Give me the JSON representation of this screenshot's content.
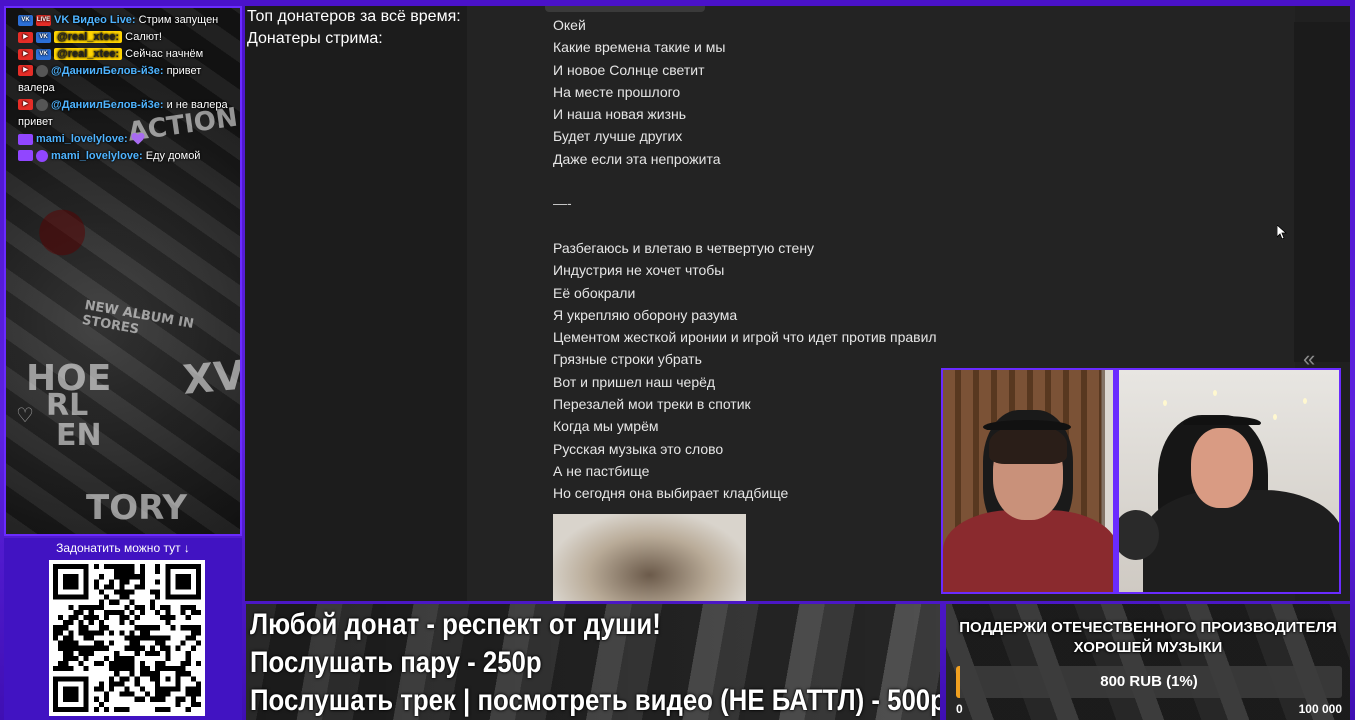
{
  "chat": {
    "messages": [
      {
        "badges": [
          "vk",
          "live"
        ],
        "nick": "VK Видео Live:",
        "nick_style": "plain",
        "text": "Стрим запущен"
      },
      {
        "badges": [
          "yt",
          "vk"
        ],
        "nick": "@real_xtee:",
        "nick_style": "highlight",
        "text": "Салют!"
      },
      {
        "badges": [
          "yt",
          "vk"
        ],
        "nick": "@real_xtee:",
        "nick_style": "highlight",
        "text": "Сейчас начнём"
      },
      {
        "badges": [
          "yt",
          "avatar"
        ],
        "nick": "@ДаниилБелов-й3е:",
        "nick_style": "plain",
        "text": "привет валера"
      },
      {
        "badges": [
          "yt",
          "avatar"
        ],
        "nick": "@ДаниилБелов-й3е:",
        "nick_style": "plain",
        "text": "и не валера привет"
      },
      {
        "badges": [
          "twitch"
        ],
        "nick": "mami_lovelylove:",
        "nick_style": "plain",
        "text": ""
      },
      {
        "badges": [
          "twitch",
          "user"
        ],
        "nick": "mami_lovelylove:",
        "nick_style": "plain",
        "text": "Еду домой"
      }
    ]
  },
  "donate": {
    "label": "Задонатить можно тут ↓"
  },
  "top_info": {
    "line1": "Топ донатеров за всё время:",
    "line2": "Донатеры стрима:"
  },
  "lyrics": [
    "Окей",
    "Какие времена такие и мы",
    "И новое Солнце светит",
    "На месте прошлого",
    "И наша новая жизнь",
    "Будет лучше других",
    "Даже если эта непрожита",
    "",
    "—-",
    "",
    "Разбегаюсь и влетаю в четвертую стену",
    "Индустрия не хочет чтобы",
    "Её обокрали",
    "Я укрепляю оборону разума",
    "Цементом жесткой иронии и игрой что идет против правил",
    "Грязные строки убрать",
    "Вот и пришел наш черёд",
    "Перезалей мои треки в спотик",
    "Когда мы умрём",
    "Русская музыка это слово",
    "А не пастбище",
    "Но сегодня она выбирает кладбище"
  ],
  "banner": {
    "line1": "Любой донат - респект от души!",
    "line2": "Послушать пару - 250р",
    "line3": "Послушать трек | посмотреть видео (НЕ БАТТЛ) - 500р"
  },
  "goal": {
    "title_line1": "ПОДДЕРЖИ ОТЕЧЕСТВЕННОГО ПРОИЗВОДИТЕЛЯ",
    "title_line2": "ХОРОШЕЙ МУЗЫКИ",
    "amount": "800 RUB (1%)",
    "progress_percent": 1,
    "min": "0",
    "max": "100 000",
    "fill_color": "#f0a020"
  },
  "colors": {
    "frame": "#5b1fd6",
    "accent": "#6a2bff",
    "nick": "#4fb4ff",
    "nick_highlight": "#ffd400"
  }
}
